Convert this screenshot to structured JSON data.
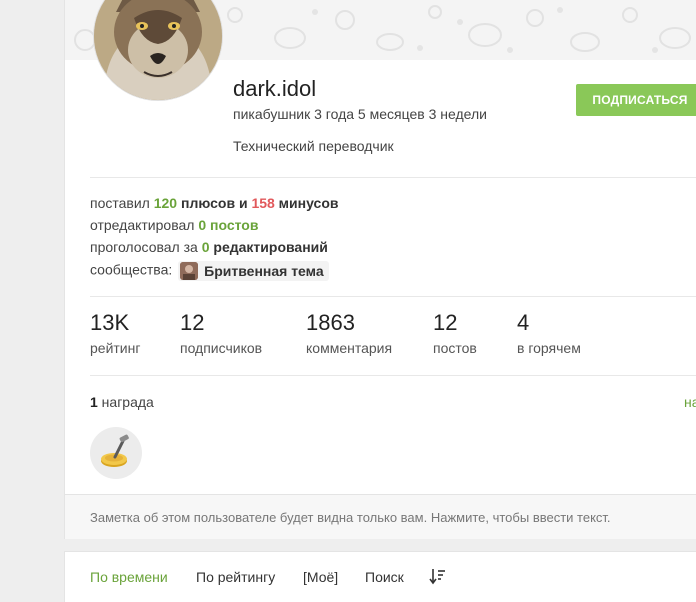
{
  "profile": {
    "username": "dark.idol",
    "tenure": "пикабушник 3 года 5 месяцев 3 недели",
    "about": "Технический переводчик",
    "subscribe_label": "ПОДПИСАТЬСЯ"
  },
  "activity": {
    "line1": {
      "prefix": "поставил ",
      "plus_count": "120",
      "middle": " плюсов и ",
      "minus_count": "158",
      "suffix": " минусов"
    },
    "line2": {
      "prefix": "отредактировал ",
      "value": "0 постов"
    },
    "line3": {
      "prefix": "проголосовал за ",
      "count": "0",
      "suffix": " редактирований"
    },
    "line4": {
      "prefix": "сообщества: ",
      "community_name": "Бритвенная тема"
    }
  },
  "counters": [
    {
      "value": "13K",
      "label": "рейтинг"
    },
    {
      "value": "12",
      "label": "подписчиков"
    },
    {
      "value": "1863",
      "label": "комментария"
    },
    {
      "value": "12",
      "label": "постов"
    },
    {
      "value": "4",
      "label": "в горячем"
    }
  ],
  "awards": {
    "count": "1",
    "label": " награда",
    "link": "на"
  },
  "note": {
    "placeholder": "Заметка об этом пользователе будет видна только вам. Нажмите, чтобы ввести текст."
  },
  "sort": {
    "items": [
      "По времени",
      "По рейтингу",
      "[Моё]",
      "Поиск"
    ],
    "active_index": 0,
    "sort_icon": "sort-order-icon"
  },
  "colors": {
    "accent": "#8ac858",
    "positive": "#6aa33a",
    "negative": "#e1585b"
  }
}
